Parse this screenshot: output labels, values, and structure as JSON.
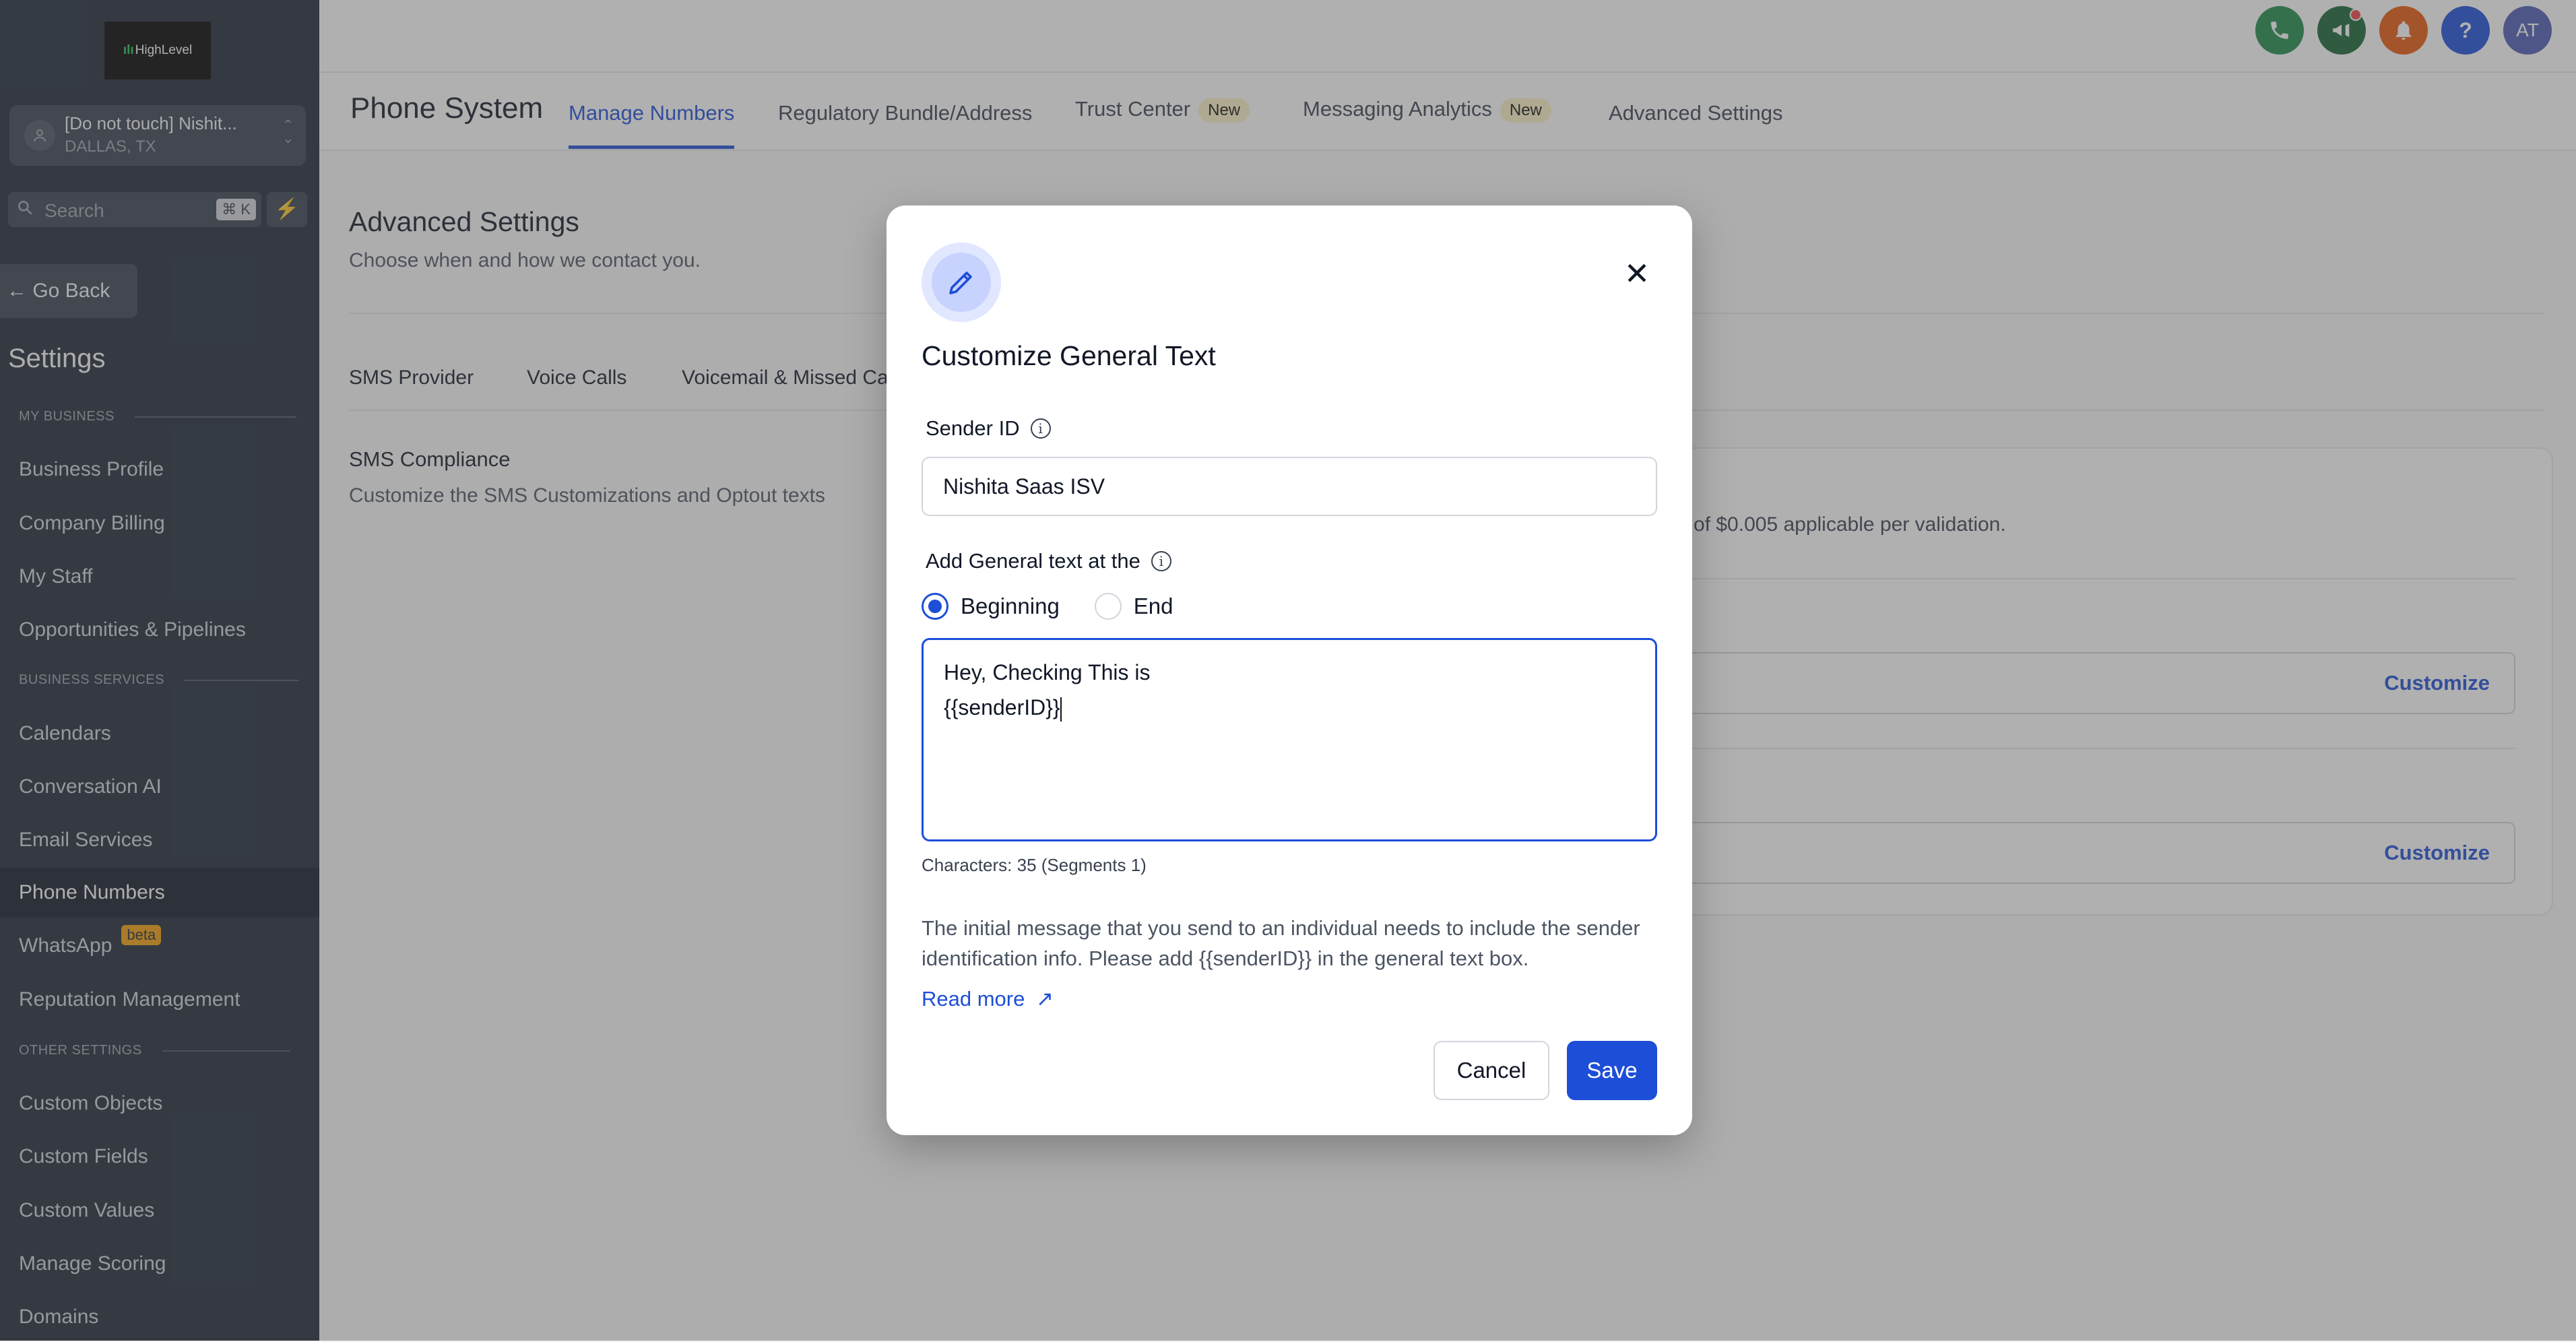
{
  "brand": {
    "logo_text": "HighLevel"
  },
  "location": {
    "name": "[Do not touch] Nishit...",
    "city": "DALLAS, TX"
  },
  "search": {
    "placeholder": "Search",
    "shortcut": "⌘ K"
  },
  "sidebar": {
    "go_back": "Go Back",
    "title": "Settings",
    "sections": {
      "my_business": "MY BUSINESS",
      "business_services": "BUSINESS SERVICES",
      "other_settings": "OTHER SETTINGS"
    },
    "items": [
      {
        "label": "Business Profile"
      },
      {
        "label": "Company Billing"
      },
      {
        "label": "My Staff"
      },
      {
        "label": "Opportunities & Pipelines"
      },
      {
        "label": "Calendars"
      },
      {
        "label": "Conversation AI"
      },
      {
        "label": "Email Services"
      },
      {
        "label": "Phone Numbers",
        "active": true
      },
      {
        "label": "WhatsApp",
        "badge": "beta"
      },
      {
        "label": "Reputation Management"
      },
      {
        "label": "Custom Objects"
      },
      {
        "label": "Custom Fields"
      },
      {
        "label": "Custom Values"
      },
      {
        "label": "Manage Scoring"
      },
      {
        "label": "Domains"
      }
    ]
  },
  "topbar": {
    "avatar_initials": "AT",
    "icons": [
      "phone-icon",
      "megaphone-icon",
      "bell-icon",
      "help-icon"
    ],
    "colors": {
      "phone": "#1f8a4c",
      "megaphone": "#166534",
      "bell": "#ea580c",
      "help": "#1d4ed8",
      "avatar": "#4b5bb5"
    }
  },
  "subnav": {
    "title": "Phone System",
    "tabs": [
      {
        "label": "Manage Numbers",
        "active": true
      },
      {
        "label": "Regulatory Bundle/Address"
      },
      {
        "label": "Trust Center",
        "badge": "New"
      },
      {
        "label": "Messaging Analytics",
        "badge": "New"
      },
      {
        "label": "Advanced Settings"
      }
    ]
  },
  "content": {
    "title": "Advanced Settings",
    "subtitle": "Choose when and how we contact you.",
    "tabs": [
      "SMS Provider",
      "Voice Calls",
      "Voicemail & Missed Ca"
    ],
    "sms_compliance_title": "SMS Compliance",
    "sms_compliance_desc": "Customize the SMS Customizations and Optout texts",
    "card_text": "ce of $0.005 applicable per validation.",
    "customize_label": "Customize"
  },
  "modal": {
    "title": "Customize General Text",
    "sender_id_label": "Sender ID",
    "sender_id_value": "Nishita Saas ISV",
    "position_label": "Add General text at the",
    "radio_options": [
      {
        "label": "Beginning",
        "checked": true
      },
      {
        "label": "End",
        "checked": false
      }
    ],
    "text_line1": "Hey, Checking This is",
    "text_line2": "{{senderID}}",
    "char_count": "Characters: 35 (Segments 1)",
    "help_text": "The initial message that you send to an individual needs to include the sender identification info. Please add {{senderID}} in the general text box.",
    "read_more": "Read more",
    "cancel": "Cancel",
    "save": "Save"
  }
}
